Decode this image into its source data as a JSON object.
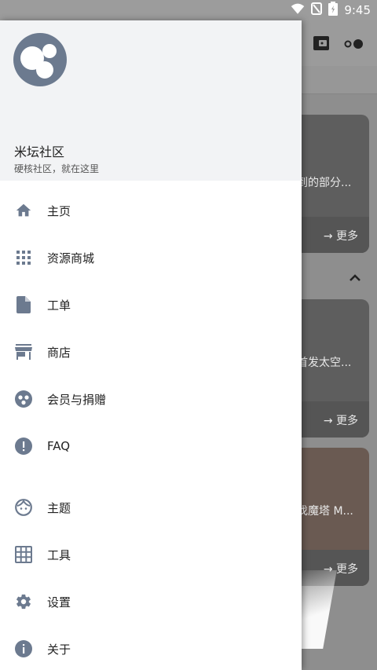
{
  "status_bar": {
    "time": "9:45",
    "icons": [
      "wifi-icon",
      "silent-icon",
      "battery-icon"
    ]
  },
  "drawer": {
    "header": {
      "app_name": "米坛社区",
      "tagline": "硬核社区，就在这里"
    },
    "items": [
      {
        "label": "主页",
        "icon": "home-icon"
      },
      {
        "label": "资源商城",
        "icon": "apps-grid-icon"
      },
      {
        "label": "工单",
        "icon": "file-icon"
      },
      {
        "label": "商店",
        "icon": "store-icon"
      },
      {
        "label": "会员与捐赠",
        "icon": "membership-icon"
      },
      {
        "label": "FAQ",
        "icon": "alert-circle-icon"
      },
      {
        "label": "主题",
        "icon": "face-icon"
      },
      {
        "label": "工具",
        "icon": "table-grid-icon"
      },
      {
        "label": "设置",
        "icon": "gear-icon"
      },
      {
        "label": "关于",
        "icon": "info-icon"
      }
    ]
  },
  "background": {
    "cards": [
      {
        "text": "到的部分...",
        "more": "→ 更多"
      },
      {
        "text": "首发太空...",
        "more": "→ 更多"
      },
      {
        "text": "伐魔塔 M...",
        "more": "→ 更多"
      }
    ]
  },
  "colors": {
    "icon": "#6c7a8f",
    "header_bg": "#f2f3f5",
    "scrim": "#8e8e8e"
  }
}
